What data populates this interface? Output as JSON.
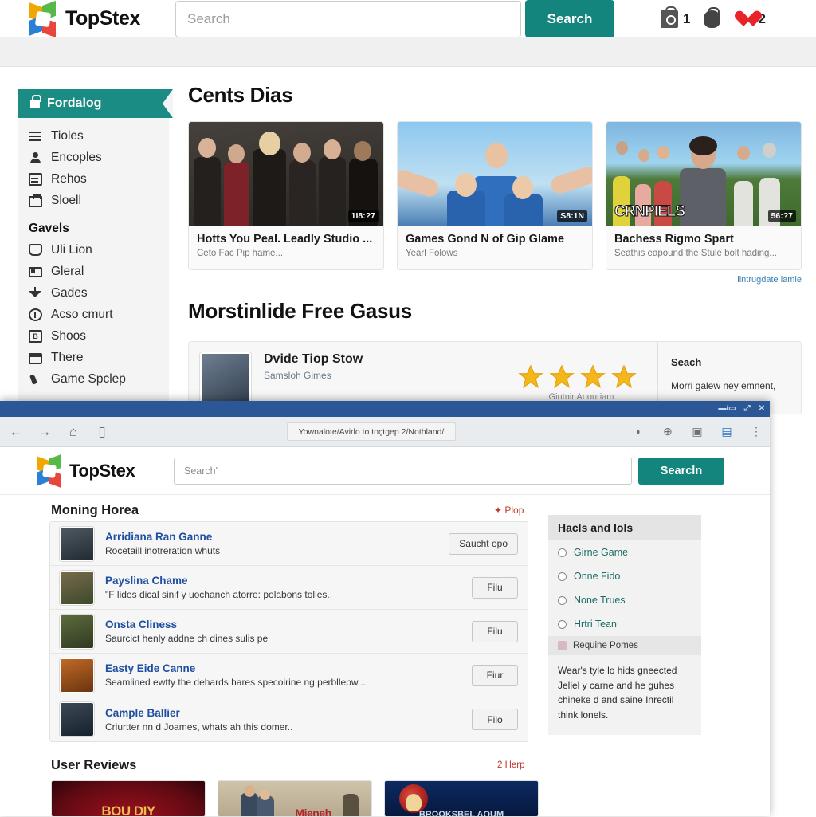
{
  "header": {
    "brand": "TopStex",
    "search_placeholder": "Search",
    "search_button": "Search",
    "icons": [
      {
        "name": "shopping-bag-icon",
        "count": "1"
      },
      {
        "name": "purse-icon",
        "count": ""
      },
      {
        "name": "heart-icon",
        "count": "2"
      }
    ]
  },
  "sidebar": {
    "active_item": {
      "label": "Fordalog",
      "icon": "lock-icon"
    },
    "items": [
      {
        "label": "Tioles",
        "icon": "menu-lines-icon"
      },
      {
        "label": "Encoples",
        "icon": "person-icon"
      },
      {
        "label": "Rehos",
        "icon": "card-box-icon"
      },
      {
        "label": "Sloell",
        "icon": "bag-icon"
      }
    ],
    "group_heading": "Gavels",
    "group_items": [
      {
        "label": "Uli Lion",
        "icon": "tag-icon"
      },
      {
        "label": "Gleral",
        "icon": "card-icon"
      },
      {
        "label": "Gades",
        "icon": "funnel-icon"
      },
      {
        "label": "Acso cmurt",
        "icon": "info-circle-icon"
      },
      {
        "label": "Shoos",
        "icon": "badge-b-icon"
      },
      {
        "label": "There",
        "icon": "calendar-icon"
      },
      {
        "label": "Game Spclep",
        "icon": "phone-icon"
      }
    ]
  },
  "main": {
    "section1_title": "Cents Dias",
    "cards": [
      {
        "title": "Hotts You Peal. Leadly Studio ...",
        "subtitle": "Ceto Fac Pip hame...",
        "duration": "1I8:?7"
      },
      {
        "title": "Games Gond N of Gip Glame",
        "subtitle": "Yearl Folows",
        "duration": "S8:1N"
      },
      {
        "title": "Bachess Rigmo Spart",
        "subtitle": "Seathis eapound the Stule bolt hading...",
        "duration": "56:?7",
        "overlay_text": "CRNPIELS"
      }
    ],
    "cards_footer_link": "lintrugdate lamie",
    "section2_title": "Morstinlide Free Gasus",
    "feature": {
      "title": "Dvide Tiop Stow",
      "subtitle": "Samsloh Gimes",
      "stars": 4,
      "stars_caption": "Gintnir Anouriam",
      "side_title": "Seach",
      "side_text": "Morri galew ney emnent,"
    }
  },
  "browser": {
    "window_controls": [
      "▬/▭",
      "⤢",
      "✕"
    ],
    "nav_icons": [
      "back-arrow-icon",
      "forward-arrow-icon",
      "home-icon",
      "tab-icon"
    ],
    "address": "Yownalote/Avirlo to toçtgep 2/Nothland/",
    "toolbar_icons": [
      "reader-icon",
      "globe-icon",
      "image-icon",
      "book-icon",
      "more-icon"
    ],
    "brand": "TopStex",
    "search_placeholder": "Search'",
    "search_button": "Searcln",
    "moning": {
      "title": "Moning Horea",
      "action_link": "✦ Plop",
      "rows": [
        {
          "name": "Arridiana Ran Ganne",
          "desc": "Rocetaill inotreration whuts",
          "button": "Saucht opo"
        },
        {
          "name": "Payslina Chame",
          "desc": "\"F lides dical sinif y uochanch atorre: polabons tolies..",
          "button": "Filu"
        },
        {
          "name": "Onsta Cliness",
          "desc": "Saurcict henly addne ch dines sulis pe",
          "button": "Filu"
        },
        {
          "name": "Easty Eide Canne",
          "desc": "Seamlined ewtty the dehards hares specoirine ng perbllepw...",
          "button": "Fiur"
        },
        {
          "name": "Cample Ballier",
          "desc": "Criurtter nn d Joames, whats ah this domer..",
          "button": "Filo"
        }
      ]
    },
    "right_panel": {
      "title": "Hacls and Iols",
      "options": [
        "Girne Game",
        "Onne Fido",
        "None Trues",
        "Hrtri Tean"
      ],
      "sub_header": "Requine Pomes",
      "body": "Wear's tyle lo hids gneected Jellel y carne and he guhes chineke d and saine Inrectil think lonels."
    },
    "user_reviews": {
      "title": "User Reviews",
      "action_link": "2 Herp",
      "cards": [
        {
          "label": "BOU DIY"
        },
        {
          "label": "Mieneh"
        },
        {
          "label": "BROOKSBEL AQUM"
        }
      ]
    }
  },
  "colors": {
    "teal": "#14857c",
    "sidebar_active": "#1a8c83",
    "link_blue": "#1f4fa0",
    "red": "#c0392b",
    "title_bar": "#2b5797"
  }
}
